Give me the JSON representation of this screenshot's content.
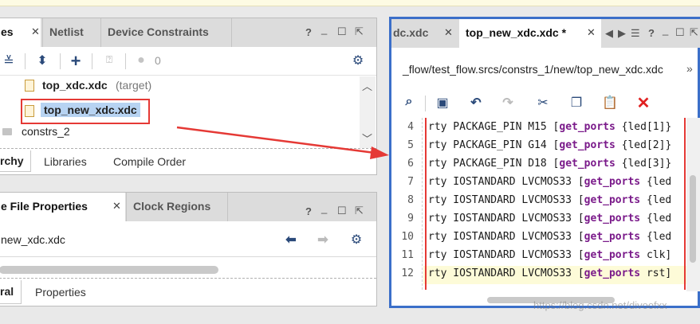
{
  "sources_panel": {
    "tabs": [
      {
        "label": "es",
        "active": true
      },
      {
        "label": "Netlist",
        "active": false
      },
      {
        "label": "Device Constraints",
        "active": false
      }
    ],
    "toolbar_count": "0",
    "tree": [
      {
        "name": "top_xdc.xdc",
        "suffix": "(target)"
      },
      {
        "name": "top_new_xdc.xdc",
        "suffix": ""
      },
      {
        "name": "constrs_2",
        "suffix": ""
      }
    ],
    "bottom_tabs": [
      "rchy",
      "Libraries",
      "Compile Order"
    ]
  },
  "props_panel": {
    "tabs": [
      {
        "label": "e File Properties",
        "active": true
      },
      {
        "label": "Clock Regions",
        "active": false
      }
    ],
    "filename": "new_xdc.xdc",
    "bottom_tabs": [
      "ral",
      "Properties"
    ]
  },
  "editor": {
    "tabs": [
      {
        "label": "dc.xdc",
        "active": false
      },
      {
        "label": "top_new_xdc.xdc *",
        "active": true
      }
    ],
    "path": "_flow/test_flow.srcs/constrs_1/new/top_new_xdc.xdc",
    "lines": [
      {
        "num": "4",
        "a": "rty PACKAGE_PIN M15 [",
        "kw": "get_ports",
        "b": " {led[1]}"
      },
      {
        "num": "5",
        "a": "rty PACKAGE_PIN G14 [",
        "kw": "get_ports",
        "b": " {led[2]}"
      },
      {
        "num": "6",
        "a": "rty PACKAGE_PIN D18 [",
        "kw": "get_ports",
        "b": " {led[3]}"
      },
      {
        "num": "7",
        "a": "rty IOSTANDARD LVCMOS33 [",
        "kw": "get_ports",
        "b": " {led"
      },
      {
        "num": "8",
        "a": "rty IOSTANDARD LVCMOS33 [",
        "kw": "get_ports",
        "b": " {led"
      },
      {
        "num": "9",
        "a": "rty IOSTANDARD LVCMOS33 [",
        "kw": "get_ports",
        "b": " {led"
      },
      {
        "num": "10",
        "a": "rty IOSTANDARD LVCMOS33 [",
        "kw": "get_ports",
        "b": " {led"
      },
      {
        "num": "11",
        "a": "rty IOSTANDARD LVCMOS33 [",
        "kw": "get_ports",
        "b": " clk]"
      },
      {
        "num": "12",
        "a": "rty IOSTANDARD LVCMOS33 [",
        "kw": "get_ports",
        "b": " rst]"
      }
    ],
    "watermark": "https://blog.csdn.net/divoofxx"
  },
  "colors": {
    "annotation_red": "#e53935",
    "editor_border": "#3b6fc9",
    "keyword": "#7a1a8a"
  },
  "icons": [
    "collapse-all-icon",
    "expand-icon",
    "add-icon",
    "help-icon",
    "status-dot-icon",
    "gear-icon",
    "back-icon",
    "forward-icon",
    "search-icon",
    "save-icon",
    "undo-icon",
    "redo-icon",
    "cut-icon",
    "copy-icon",
    "paste-icon",
    "delete-icon"
  ]
}
